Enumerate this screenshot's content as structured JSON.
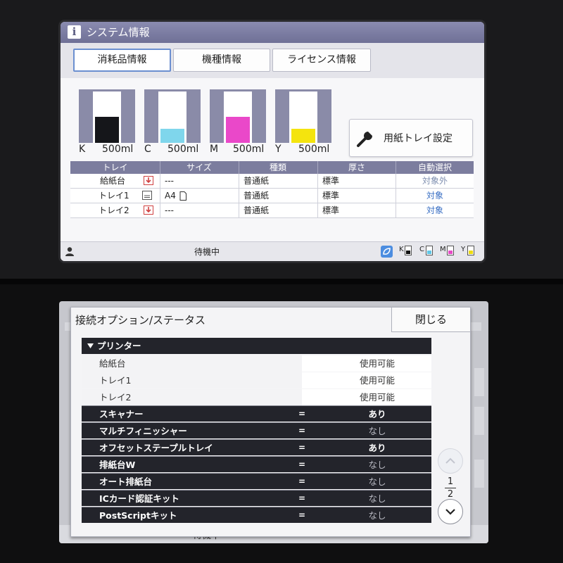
{
  "system_info_screen": {
    "title": "システム情報",
    "tabs": [
      {
        "label": "消耗品情報",
        "active": true
      },
      {
        "label": "機種情報",
        "active": false
      },
      {
        "label": "ライセンス情報",
        "active": false
      }
    ],
    "cartridges": [
      {
        "color_name": "K",
        "amount": "500ml",
        "fill_level": 0.5,
        "color": "#15161a"
      },
      {
        "color_name": "C",
        "amount": "500ml",
        "fill_level": 0.27,
        "color": "#7fd6ec"
      },
      {
        "color_name": "M",
        "amount": "500ml",
        "fill_level": 0.5,
        "color": "#ea48c9"
      },
      {
        "color_name": "Y",
        "amount": "500ml",
        "fill_level": 0.27,
        "color": "#f4e40e"
      }
    ],
    "tray_settings_button": "用紙トレイ設定",
    "tray_table": {
      "headers": [
        "トレイ",
        "サイズ",
        "種類",
        "厚さ",
        "自動選択"
      ],
      "rows": [
        {
          "tray": "給紙台",
          "size": "---",
          "type": "普通紙",
          "thickness": "標準",
          "auto": "対象外"
        },
        {
          "tray": "トレイ1",
          "size": "A4",
          "type": "普通紙",
          "thickness": "標準",
          "auto": "対象"
        },
        {
          "tray": "トレイ2",
          "size": "---",
          "type": "普通紙",
          "thickness": "標準",
          "auto": "対象"
        }
      ]
    },
    "status_text": "待機中",
    "toner_indicators": [
      "K",
      "C",
      "M",
      "Y"
    ]
  },
  "connection_screen": {
    "title": "接続オプション/ステータス",
    "close_label": "閉じる",
    "printer_section": "プリンター",
    "printer_items": [
      {
        "name": "給紙台",
        "value": "使用可能"
      },
      {
        "name": "トレイ1",
        "value": "使用可能"
      },
      {
        "name": "トレイ2",
        "value": "使用可能"
      }
    ],
    "options": [
      {
        "name": "スキャナー",
        "eq": "=",
        "value": "あり"
      },
      {
        "name": "マルチフィニッシャー",
        "eq": "=",
        "value": "なし"
      },
      {
        "name": "オフセットステープルトレイ",
        "eq": "=",
        "value": "あり"
      },
      {
        "name": "排紙台W",
        "eq": "=",
        "value": "なし"
      },
      {
        "name": "オート排紙台",
        "eq": "=",
        "value": "なし"
      },
      {
        "name": "ICカード認証キット",
        "eq": "=",
        "value": "なし"
      },
      {
        "name": "PostScriptキット",
        "eq": "=",
        "value": "なし"
      }
    ],
    "page_current": "1",
    "page_total": "2",
    "behind_status": "待機中"
  },
  "colors": {
    "header_purple": "#6f7096",
    "table_header": "#7c7d9e",
    "auto_blue": "#3a6fc4",
    "dark_row": "#23242b"
  }
}
